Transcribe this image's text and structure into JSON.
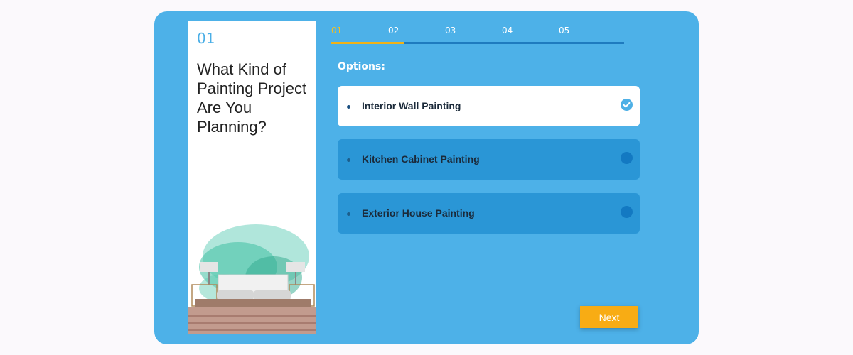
{
  "step": {
    "number": "01",
    "question": "What Kind of Painting Project Are You Planning?"
  },
  "progress": {
    "steps": [
      "01",
      "02",
      "03",
      "04",
      "05"
    ],
    "active_index": 0,
    "fraction_complete": 0.25
  },
  "options": {
    "heading": "Options:",
    "items": [
      {
        "label": "Interior Wall Painting",
        "selected": true
      },
      {
        "label": "Kitchen Cabinet Painting",
        "selected": false
      },
      {
        "label": "Exterior House Painting",
        "selected": false
      }
    ]
  },
  "next_label": "Next",
  "colors": {
    "card": "#4db1e8",
    "accent": "#f8ac14",
    "option": "#2a96d6",
    "active_step": "#f7c01b"
  },
  "icons": {
    "selected": "check-circle-icon",
    "unselected": "radio-circle-icon"
  }
}
